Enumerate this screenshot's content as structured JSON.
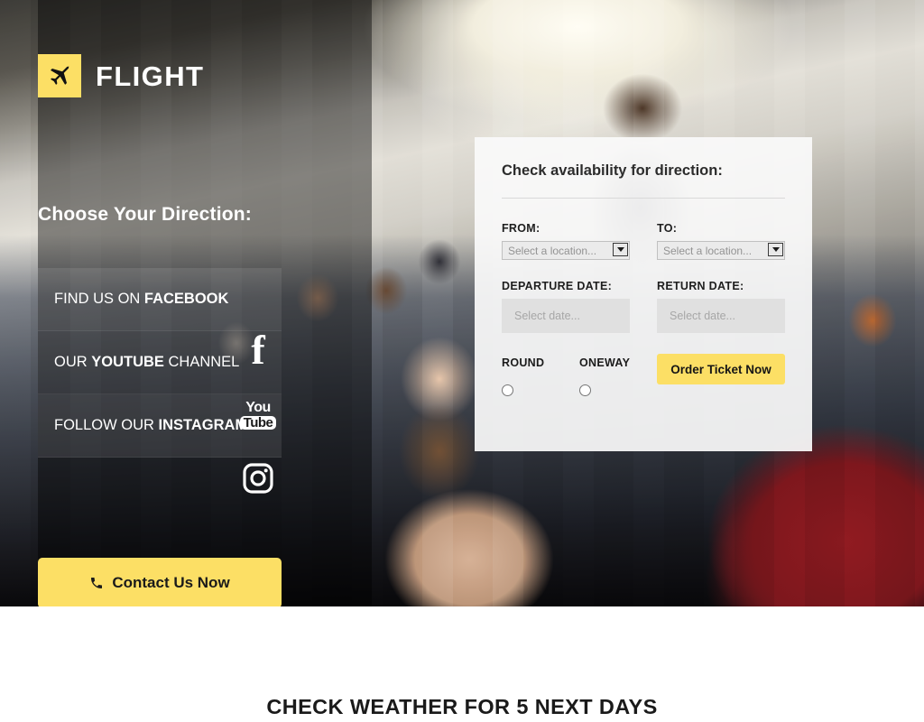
{
  "brand": {
    "name": "FLIGHT",
    "logo_icon": "airplane-icon",
    "badge_color": "#fcdf65"
  },
  "hero": {
    "headline": "Choose Your Direction:",
    "social_links": [
      {
        "prefix": "FIND US ON ",
        "strong": "FACEBOOK",
        "suffix": "",
        "icon": "facebook-icon"
      },
      {
        "prefix": "OUR ",
        "strong": "YOUTUBE",
        "suffix": " CHANNEL",
        "icon": "youtube-icon"
      },
      {
        "prefix": "FOLLOW OUR ",
        "strong": "INSTAGRAM",
        "suffix": "",
        "icon": "instagram-icon"
      }
    ],
    "social_icon_labels": {
      "facebook": "f",
      "youtube_top": "You",
      "youtube_bottom": "Tube"
    },
    "contact_button": {
      "label": "Contact Us Now",
      "icon": "phone-icon",
      "color": "#fcdf65"
    }
  },
  "booking": {
    "title": "Check availability for direction:",
    "from": {
      "label": "FROM:",
      "value": "Select a location...",
      "icon": "chevron-down-icon"
    },
    "to": {
      "label": "TO:",
      "value": "Select a location...",
      "icon": "chevron-down-icon"
    },
    "departure": {
      "label": "DEPARTURE DATE:",
      "placeholder": "Select date...",
      "value": ""
    },
    "return": {
      "label": "RETURN DATE:",
      "placeholder": "Select date...",
      "value": ""
    },
    "trip_types": [
      {
        "label": "ROUND",
        "checked": false
      },
      {
        "label": "ONEWAY",
        "checked": false
      }
    ],
    "submit": {
      "label": "Order Ticket Now",
      "color": "#fcdf65"
    }
  },
  "weather": {
    "heading": "CHECK WEATHER FOR 5 NEXT DAYS"
  }
}
